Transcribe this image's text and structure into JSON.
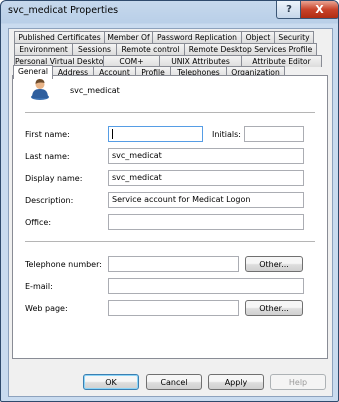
{
  "window": {
    "title": "svc_medicat Properties",
    "help_glyph": "?",
    "close_glyph": "X"
  },
  "tabs": {
    "row1": [
      "Published Certificates",
      "Member Of",
      "Password Replication",
      "Object",
      "Security"
    ],
    "row2": [
      "Environment",
      "Sessions",
      "Remote control",
      "Remote Desktop Services Profile"
    ],
    "row3": [
      "Personal Virtual Desktop",
      "COM+",
      "UNIX Attributes",
      "Attribute Editor"
    ],
    "row4": [
      "General",
      "Address",
      "Account",
      "Profile",
      "Telephones",
      "Organization"
    ],
    "active": "General"
  },
  "general": {
    "display_heading": "svc_medicat",
    "first_name": {
      "label": "First name:",
      "value": ""
    },
    "initials": {
      "label": "Initials:",
      "value": ""
    },
    "last_name": {
      "label": "Last name:",
      "value": "svc_medicat"
    },
    "display_name": {
      "label": "Display name:",
      "value": "svc_medicat"
    },
    "description": {
      "label": "Description:",
      "value": "Service account for Medicat Logon"
    },
    "office": {
      "label": "Office:",
      "value": ""
    },
    "telephone": {
      "label": "Telephone number:",
      "value": "",
      "other_label": "Other..."
    },
    "email": {
      "label": "E-mail:",
      "value": ""
    },
    "web_page": {
      "label": "Web page:",
      "value": "",
      "other_label": "Other..."
    }
  },
  "footer": {
    "ok": "OK",
    "cancel": "Cancel",
    "apply": "Apply",
    "help": "Help"
  },
  "icons": {
    "user": "user-icon"
  }
}
